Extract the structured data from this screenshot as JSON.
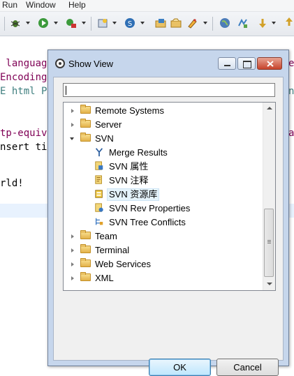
{
  "menubar": {
    "items": [
      "Run",
      "Window",
      "Help"
    ]
  },
  "toolbar": {
    "icons": [
      "bug-icon",
      "run-icon",
      "external-tools-icon",
      "new-server-icon",
      "svn-icon",
      "open-type-icon",
      "open-resource-icon",
      "pen-icon",
      "globe-icon",
      "next-annotation-icon",
      "navigate-icon"
    ]
  },
  "editor": {
    "lines": [
      {
        "text": " languag",
        "color": "#7f0055",
        "right": "e"
      },
      {
        "text": "Encoding",
        "color": "#7f0055",
        "right": ""
      },
      {
        "text": "E html P",
        "color": "#3f7f7f",
        "right": "n"
      },
      {
        "text": "",
        "color": "#000000",
        "right": ""
      },
      {
        "text": "tp-equiv",
        "color": "#7f0055",
        "right": "a"
      },
      {
        "text": "nsert ti",
        "color": "#000000",
        "right": ""
      },
      {
        "text": "",
        "color": "#000000",
        "right": ""
      },
      {
        "text": "rld!",
        "color": "#000000",
        "right": ""
      }
    ]
  },
  "dialog": {
    "title": "Show View",
    "filter_value": "",
    "tree": [
      {
        "label": "Remote Systems",
        "icon": "folder",
        "expandable": true,
        "expanded": false,
        "level": 0
      },
      {
        "label": "Server",
        "icon": "folder",
        "expandable": true,
        "expanded": false,
        "level": 0
      },
      {
        "label": "SVN",
        "icon": "folder",
        "expandable": true,
        "expanded": true,
        "level": 0
      },
      {
        "label": "Merge Results",
        "icon": "merge-icon",
        "expandable": false,
        "level": 1
      },
      {
        "label": "SVN 属性",
        "icon": "svn-properties-icon",
        "expandable": false,
        "level": 1
      },
      {
        "label": "SVN 注释",
        "icon": "svn-annotate-icon",
        "expandable": false,
        "level": 1
      },
      {
        "label": "SVN 资源库",
        "icon": "svn-repository-icon",
        "expandable": false,
        "level": 1,
        "selected": true
      },
      {
        "label": "SVN Rev Properties",
        "icon": "svn-rev-properties-icon",
        "expandable": false,
        "level": 1
      },
      {
        "label": "SVN Tree Conflicts",
        "icon": "tree-conflicts-icon",
        "expandable": false,
        "level": 1
      },
      {
        "label": "Team",
        "icon": "folder",
        "expandable": true,
        "expanded": false,
        "level": 0
      },
      {
        "label": "Terminal",
        "icon": "folder",
        "expandable": true,
        "expanded": false,
        "level": 0
      },
      {
        "label": "Web Services",
        "icon": "folder",
        "expandable": true,
        "expanded": false,
        "level": 0
      },
      {
        "label": "XML",
        "icon": "folder",
        "expandable": true,
        "expanded": false,
        "level": 0
      }
    ],
    "ok_label": "OK",
    "cancel_label": "Cancel"
  },
  "colors": {
    "dialog_frame": "#c6d6ec",
    "selection": "#e5f3fb",
    "close_button": "#c7432b"
  }
}
